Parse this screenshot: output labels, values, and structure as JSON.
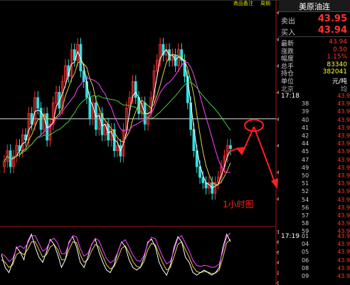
{
  "top_links": [
    "商品备注",
    "周期"
  ],
  "quote": {
    "name": "美原油连",
    "sell_label": "卖出",
    "sell_price": "43.95",
    "buy_label": "买入",
    "buy_price": "43.94",
    "stats": [
      {
        "label": "最新",
        "value": "43.94"
      },
      {
        "label": "涨跌",
        "value": "0.50"
      },
      {
        "label": "幅度",
        "value": "1.15%"
      },
      {
        "label": "总手",
        "value": "83340"
      },
      {
        "label": "持仓",
        "value": "382041"
      },
      {
        "label": "单位",
        "value": "元/吨"
      }
    ],
    "section_label": "北京",
    "section_right": "均",
    "ticks_a": {
      "time": "17:18",
      "rows": [
        {
          "t": "",
          "p": "43.9"
        },
        {
          "t": "38",
          "p": "43.9"
        },
        {
          "t": "39",
          "p": "43.9"
        },
        {
          "t": "40",
          "p": "43.9"
        },
        {
          "t": "41",
          "p": "43.9"
        },
        {
          "t": "42",
          "p": "43.9"
        },
        {
          "t": "44",
          "p": "43.9"
        },
        {
          "t": "45",
          "p": "43.9"
        },
        {
          "t": "47",
          "p": "43.9"
        },
        {
          "t": "49",
          "p": "43.9"
        },
        {
          "t": "50",
          "p": "43.9"
        },
        {
          "t": "51",
          "p": "43.9"
        },
        {
          "t": "52",
          "p": "43.9"
        },
        {
          "t": "54",
          "p": "43.9"
        },
        {
          "t": "56",
          "p": "43.9"
        },
        {
          "t": "57",
          "p": "43.9"
        },
        {
          "t": "58",
          "p": "43.9"
        },
        {
          "t": "59",
          "p": "43.9"
        }
      ]
    },
    "ticks_b": {
      "time": "17:19",
      "rows": [
        {
          "t": "01",
          "p": "43.9"
        },
        {
          "t": "04",
          "p": "43.9"
        },
        {
          "t": "05",
          "p": "43.9"
        },
        {
          "t": "06",
          "p": "43.9"
        },
        {
          "t": "08",
          "p": "43.9"
        },
        {
          "t": "09",
          "p": "43.9"
        }
      ]
    }
  },
  "chart_data": {
    "type": "candlestick",
    "price_axis": {
      "ticks": [
        "46.5",
        "46.0",
        "45.5",
        "45.0",
        "44.5",
        "44.0",
        "43.5",
        "43.0"
      ],
      "ylim": [
        42.85,
        46.6
      ]
    },
    "indicator_axis": {
      "ticks": [
        "100",
        "80",
        "60",
        "40",
        "20",
        "0"
      ],
      "ylim": [
        0,
        100
      ]
    },
    "reference_line": 44.5,
    "annotation": "1小时图",
    "colors": {
      "up": "#ff3333",
      "down": "#33e0e0",
      "ma_fast": "#ffffff",
      "ma_mid": "#e0d040",
      "ma_slow": "#ff44ff",
      "ma_long": "#40d040",
      "ref": "#dddddd",
      "arrow": "#ff2020"
    },
    "closes": [
      43.7,
      43.9,
      43.6,
      43.8,
      44.0,
      43.9,
      44.2,
      44.1,
      44.6,
      44.4,
      44.9,
      44.7,
      44.3,
      44.6,
      44.1,
      44.4,
      44.8,
      45.0,
      44.7,
      45.2,
      45.5,
      45.3,
      45.8,
      45.6,
      45.9,
      45.4,
      45.2,
      44.9,
      44.5,
      44.8,
      44.3,
      44.6,
      44.2,
      44.4,
      44.1,
      44.3,
      43.9,
      44.0,
      43.8,
      44.3,
      44.7,
      44.9,
      45.2,
      44.9,
      44.6,
      44.8,
      44.4,
      44.6,
      44.9,
      45.4,
      45.6,
      45.9,
      45.7,
      45.8,
      45.6,
      45.7,
      45.5,
      45.8,
      45.6,
      45.3,
      44.8,
      44.3,
      43.9,
      43.6,
      43.4,
      43.3,
      43.2,
      43.3,
      43.1,
      43.3,
      43.4,
      43.6,
      43.8,
      44.0,
      43.94
    ],
    "indicator_lines": {
      "fast": [
        55,
        30,
        20,
        40,
        70,
        60,
        45,
        80,
        95,
        70,
        50,
        40,
        60,
        85,
        75,
        55,
        30,
        45,
        80,
        90,
        70,
        40,
        30,
        50,
        75,
        85,
        60,
        40,
        25,
        20,
        35,
        60,
        80,
        70,
        45,
        30,
        25,
        30,
        50,
        80,
        85,
        70,
        40,
        25,
        15,
        35,
        70,
        90,
        80,
        50,
        40,
        20,
        15,
        20,
        25,
        20,
        15,
        20,
        30,
        70,
        95,
        80
      ],
      "slow": [
        45,
        40,
        30,
        35,
        55,
        60,
        55,
        65,
        80,
        80,
        65,
        50,
        55,
        70,
        75,
        65,
        45,
        45,
        65,
        80,
        78,
        55,
        40,
        45,
        62,
        75,
        70,
        52,
        35,
        27,
        32,
        48,
        67,
        72,
        58,
        42,
        32,
        30,
        42,
        65,
        77,
        74,
        55,
        38,
        25,
        30,
        52,
        75,
        80,
        65,
        50,
        32,
        22,
        20,
        22,
        21,
        18,
        19,
        25,
        50,
        78,
        85
      ]
    }
  }
}
